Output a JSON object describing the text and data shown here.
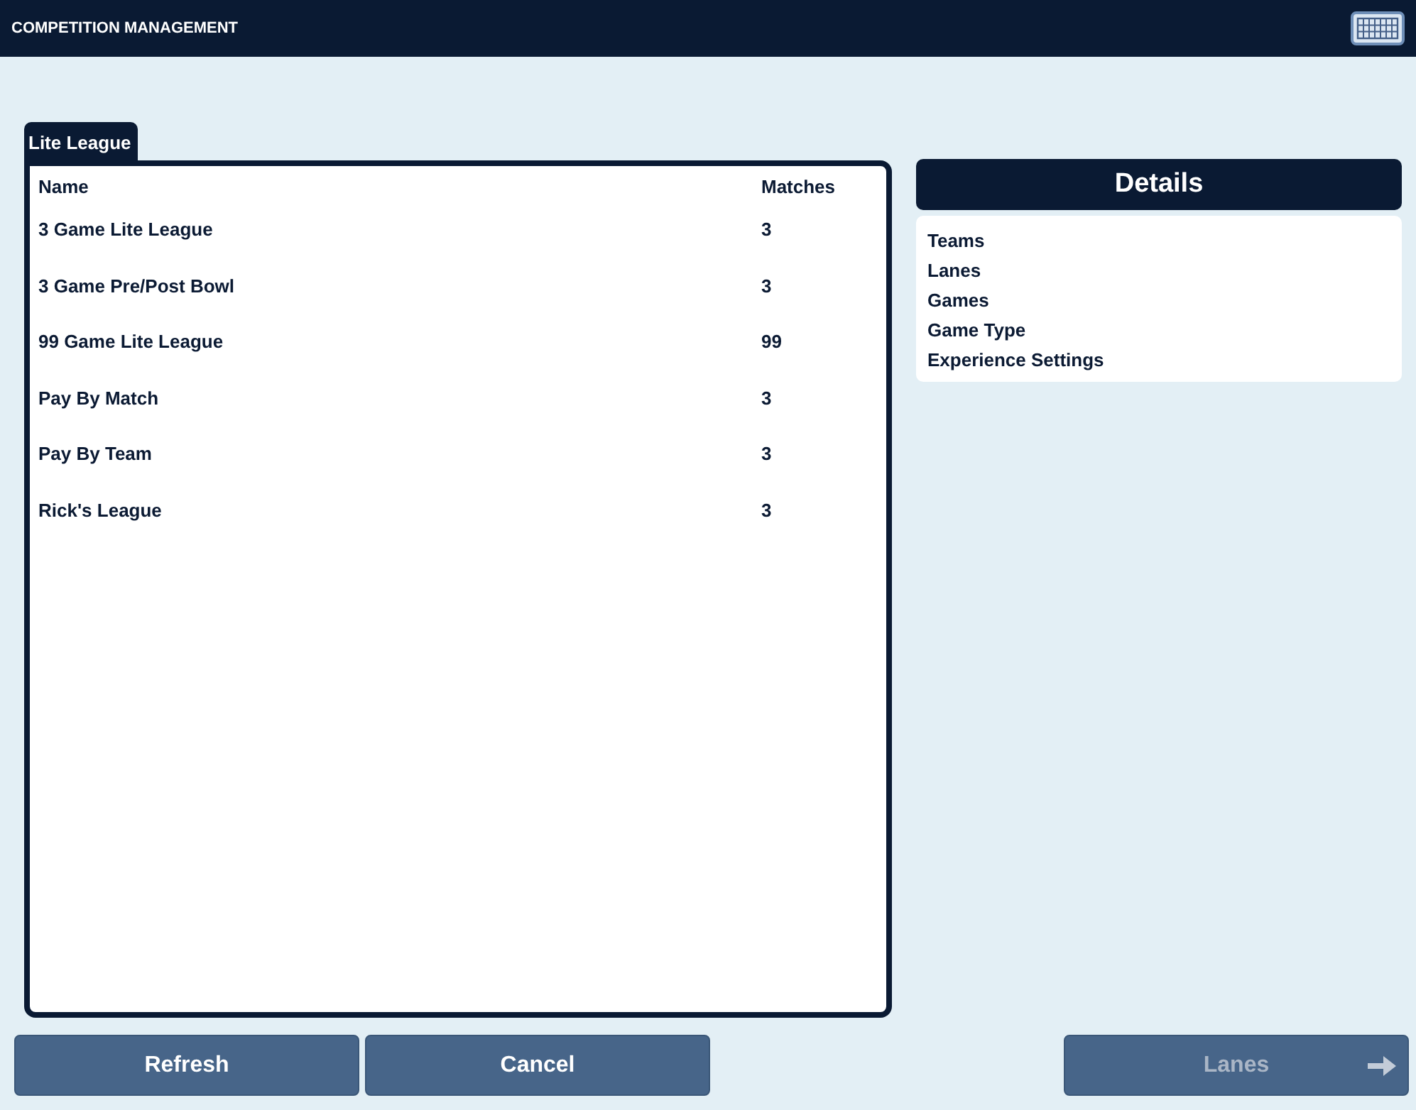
{
  "window": {
    "title": "COMPETITION MANAGEMENT"
  },
  "tabs": [
    {
      "label": "Lite League",
      "selected": true
    }
  ],
  "table": {
    "columns": [
      "Name",
      "Matches"
    ],
    "rows": [
      [
        "3 Game Lite League",
        "3"
      ],
      [
        "3 Game Pre/Post Bowl",
        "3"
      ],
      [
        "99 Game Lite League",
        "99"
      ],
      [
        "Pay By Match",
        "3"
      ],
      [
        "Pay By Team",
        "3"
      ],
      [
        "Rick's League",
        "3"
      ]
    ]
  },
  "details": {
    "title": "Details",
    "items": [
      "Teams",
      "Lanes",
      "Games",
      "Game Type",
      "Experience Settings"
    ]
  },
  "buttons": [
    {
      "label": "Refresh",
      "disabled": false,
      "kind": "plain"
    },
    {
      "label": "Cancel",
      "disabled": false,
      "kind": "plain"
    },
    {
      "label": "Lanes",
      "disabled": true,
      "kind": "next"
    }
  ]
}
